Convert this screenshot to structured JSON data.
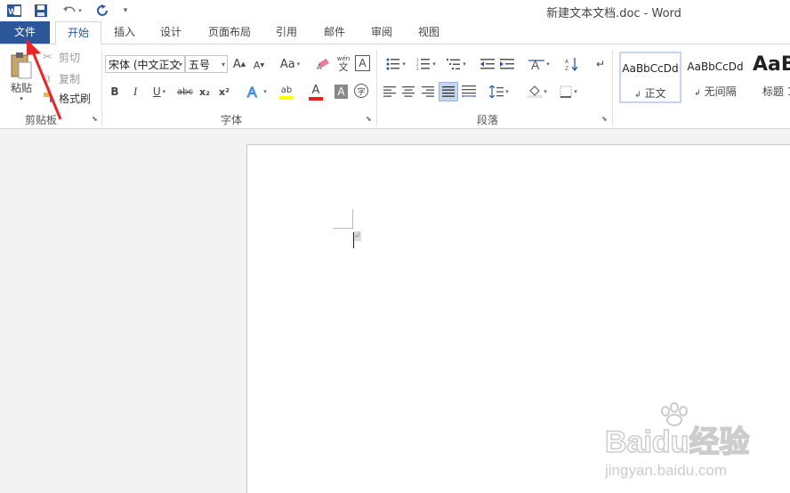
{
  "window": {
    "title": "新建文本文档.doc - Word"
  },
  "qat": {
    "undo_icon": "undo-icon",
    "redo_icon": "redo-icon",
    "save_icon": "save-icon",
    "customize": "▾"
  },
  "tabs": [
    {
      "label": "文件"
    },
    {
      "label": "开始"
    },
    {
      "label": "插入"
    },
    {
      "label": "设计"
    },
    {
      "label": "页面布局"
    },
    {
      "label": "引用"
    },
    {
      "label": "邮件"
    },
    {
      "label": "审阅"
    },
    {
      "label": "视图"
    }
  ],
  "clipboard": {
    "paste_label": "粘贴",
    "cut_label": "剪切",
    "copy_label": "复制",
    "format_painter_label": "格式刷",
    "group_label": "剪贴板"
  },
  "font": {
    "font_name": "宋体 (中文正文",
    "font_size": "五号",
    "grow": "A",
    "shrink": "A",
    "case": "Aa",
    "bold": "B",
    "italic": "I",
    "underline": "U",
    "strike": "abc",
    "subscript": "x₂",
    "superscript": "x²",
    "phonetic": "wén",
    "phonetic_char": "文",
    "border_char": "A",
    "shade_char": "A",
    "enclose_char": "字",
    "highlight": "ab",
    "color_a": "A",
    "group_label": "字体"
  },
  "paragraph": {
    "group_label": "段落"
  },
  "styles": [
    {
      "sample": "AaBbCcDd",
      "name": "正文",
      "mark": "↲"
    },
    {
      "sample": "AaBbCcDd",
      "name": "无间隔",
      "mark": "↲"
    },
    {
      "sample": "AaB",
      "name": "标题 1"
    }
  ],
  "document": {
    "paragraph_mark": "↲"
  },
  "watermark": {
    "brand": "Baidu经验",
    "url": "jingyan.baidu.com"
  },
  "colors": {
    "accent": "#2b579a",
    "arrow": "#e8262a",
    "font_color_bar": "#e81e1e",
    "highlight_bar": "#ffff00"
  }
}
